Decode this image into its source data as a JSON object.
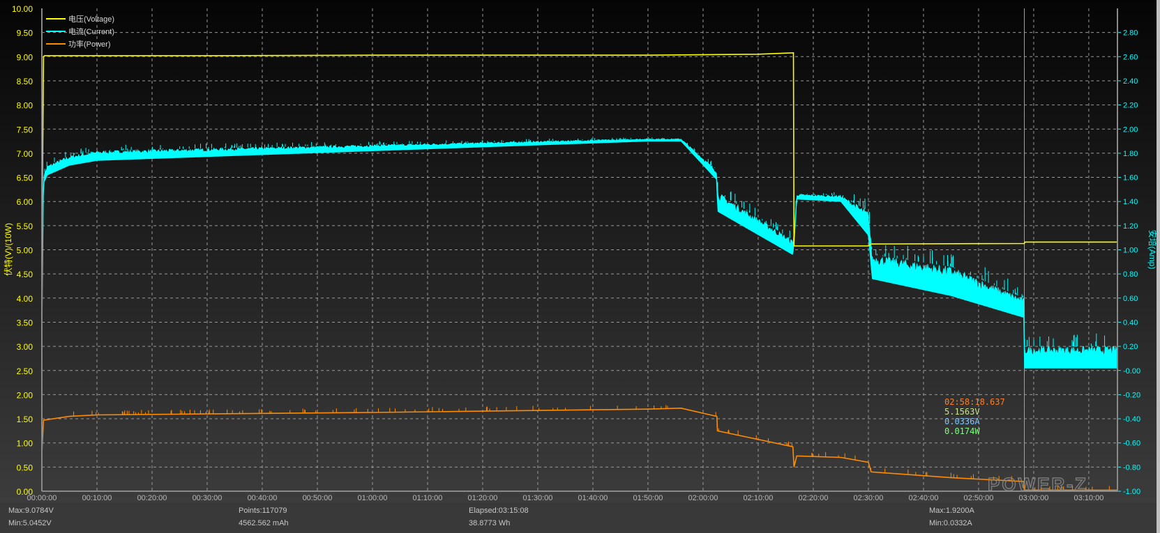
{
  "chart_data": {
    "type": "line",
    "legend": [
      {
        "name": "电压(Voltage)",
        "color": "#ffff00"
      },
      {
        "name": "电流(Current)",
        "color": "#00ffff"
      },
      {
        "name": "功率(Power)",
        "color": "#ff8c00"
      }
    ],
    "legend_position": "top-left",
    "ylabel_left": "伏特(V)/(10W)",
    "ylabel_right": "安培(Amp)",
    "ylim_left": [
      0,
      10
    ],
    "ylim_right": [
      -1,
      3
    ],
    "xlim_minutes": [
      0,
      195.2
    ],
    "yticks_left": [
      "0.00",
      "0.50",
      "1.00",
      "1.50",
      "2.00",
      "2.50",
      "3.00",
      "3.50",
      "4.00",
      "4.50",
      "5.00",
      "5.50",
      "6.00",
      "6.50",
      "7.00",
      "7.50",
      "8.00",
      "8.50",
      "9.00",
      "9.50",
      "10.00"
    ],
    "yticks_right": [
      "-1.00",
      "-0.80",
      "-0.60",
      "-0.40",
      "-0.20",
      "-0.00",
      "0.20",
      "0.40",
      "0.60",
      "0.80",
      "1.00",
      "1.20",
      "1.40",
      "1.60",
      "1.80",
      "2.00",
      "2.20",
      "2.40",
      "2.60",
      "2.80"
    ],
    "xticks": [
      "00:00:00",
      "00:10:00",
      "00:20:00",
      "00:30:00",
      "00:40:00",
      "00:50:00",
      "01:00:00",
      "01:10:00",
      "01:20:00",
      "01:30:00",
      "01:40:00",
      "01:50:00",
      "02:00:00",
      "02:10:00",
      "02:20:00",
      "02:30:00",
      "02:40:00",
      "02:50:00",
      "03:00:00",
      "03:10:00"
    ],
    "grid": true,
    "series": [
      {
        "name": "Voltage (V)",
        "axis": "left",
        "t_min": [
          0,
          0.3,
          0.5,
          30,
          60,
          110,
          130,
          136.4,
          136.5,
          150,
          150.5,
          178.3,
          178.4,
          195.2
        ],
        "values": [
          5.0,
          9.0,
          9.02,
          9.02,
          9.03,
          9.03,
          9.05,
          9.08,
          5.08,
          5.08,
          5.12,
          5.13,
          5.16,
          5.16
        ]
      },
      {
        "name": "Current low (A)",
        "axis": "right",
        "t_min": [
          0,
          0.3,
          1,
          5,
          10,
          60,
          110,
          116,
          122.5,
          122.6,
          136.3,
          136.6,
          137,
          145,
          150,
          150.7,
          165,
          178.2,
          178.3,
          195.2
        ],
        "values": [
          0.2,
          1.55,
          1.62,
          1.7,
          1.74,
          1.82,
          1.9,
          1.9,
          1.58,
          1.32,
          0.96,
          1.1,
          1.42,
          1.4,
          1.12,
          0.76,
          0.62,
          0.44,
          0.02,
          0.02
        ]
      },
      {
        "name": "Current high (A)",
        "axis": "right",
        "t_min": [
          0,
          0.3,
          1,
          5,
          10,
          60,
          110,
          116,
          122.5,
          122.6,
          136.3,
          136.6,
          137,
          145,
          150,
          150.7,
          165,
          178.2,
          178.3,
          195.2
        ],
        "values": [
          0.4,
          1.62,
          1.7,
          1.78,
          1.82,
          1.87,
          1.92,
          1.92,
          1.66,
          1.48,
          1.08,
          1.2,
          1.46,
          1.45,
          1.32,
          0.96,
          0.86,
          0.6,
          0.2,
          0.2
        ]
      },
      {
        "name": "Power (10W)",
        "axis": "left",
        "t_min": [
          0,
          0.3,
          5,
          10,
          60,
          110,
          116,
          122.5,
          122.6,
          136.3,
          136.5,
          137,
          145,
          150,
          150.5,
          165,
          178.2,
          178.3,
          195.2
        ],
        "values": [
          0.8,
          1.47,
          1.55,
          1.58,
          1.63,
          1.7,
          1.72,
          1.55,
          1.25,
          0.92,
          0.5,
          0.73,
          0.7,
          0.6,
          0.4,
          0.28,
          0.2,
          0.02,
          0.02
        ]
      }
    ],
    "cursor": {
      "time": "02:58:18.637",
      "t_min": 178.3,
      "voltage": "5.1563V",
      "current": "0.0336A",
      "power": "0.0174W"
    }
  },
  "stats": {
    "vmax": "Max:9.0784V",
    "vmin": "Min:5.0452V",
    "points": "Points:117079",
    "mah": "4562.562 mAh",
    "elapsed": "Elapsed:03:15:08",
    "wh": "38.8773 Wh",
    "amax": "Max:1.9200A",
    "amin": "Min:0.0332A"
  },
  "watermark": "POWER-Z",
  "colors": {
    "voltage": "#ffff00",
    "current": "#00ffff",
    "power": "#ff8c00",
    "cursor_time": "#ff7f27",
    "cursor_v": "#c8e68c",
    "cursor_a": "#7fc8ff",
    "cursor_w": "#7fff7f"
  }
}
